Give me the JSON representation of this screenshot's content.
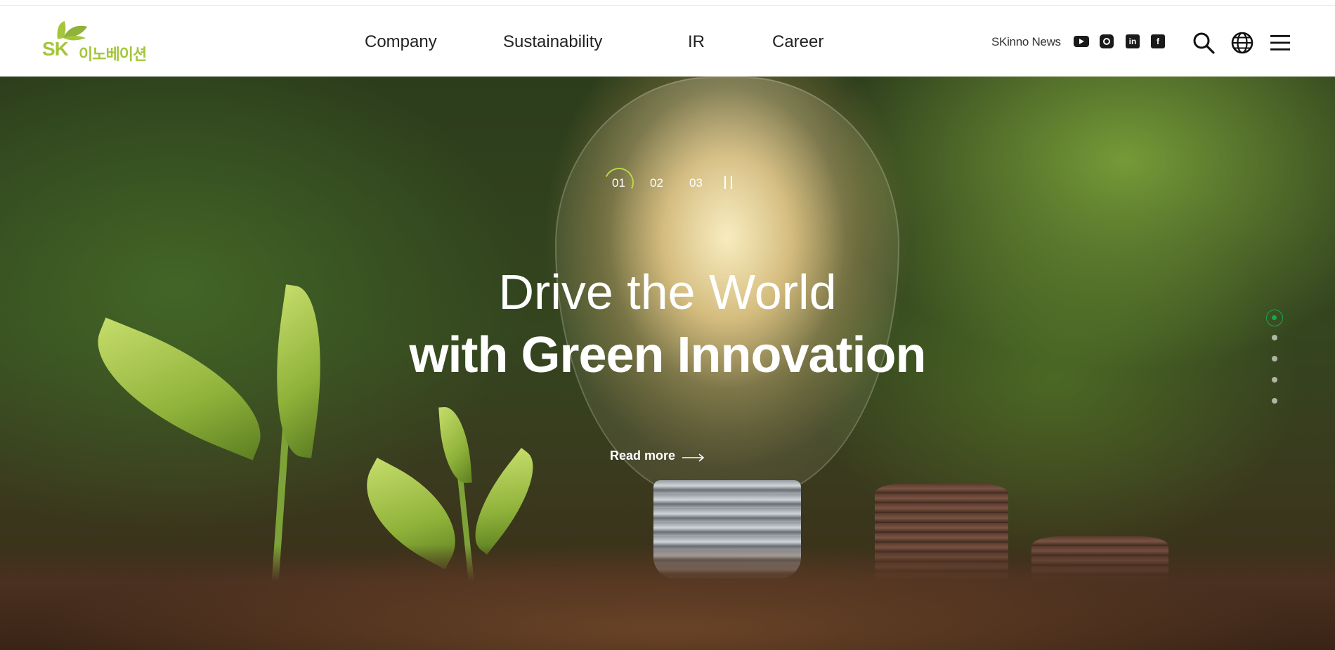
{
  "header": {
    "logo": {
      "mark": "SK",
      "wordmark": "이노베이션",
      "brand_color": "#a4c639"
    },
    "nav": [
      "Company",
      "Sustainability",
      "IR",
      "Career"
    ],
    "news_link": "SKinno News",
    "social": [
      "youtube-icon",
      "instagram-icon",
      "linkedin-icon",
      "facebook-icon"
    ],
    "utility_icons": [
      "search-icon",
      "globe-icon",
      "menu-icon"
    ]
  },
  "hero": {
    "slides": [
      "01",
      "02",
      "03"
    ],
    "active_slide": "01",
    "pause_icon": "pause-icon",
    "title_line1": "Drive the World",
    "title_line2": "with Green Innovation",
    "cta": "Read more",
    "section_dots": 5,
    "active_dot_color": "#18a64f",
    "progress_color": "#b7d94a"
  }
}
